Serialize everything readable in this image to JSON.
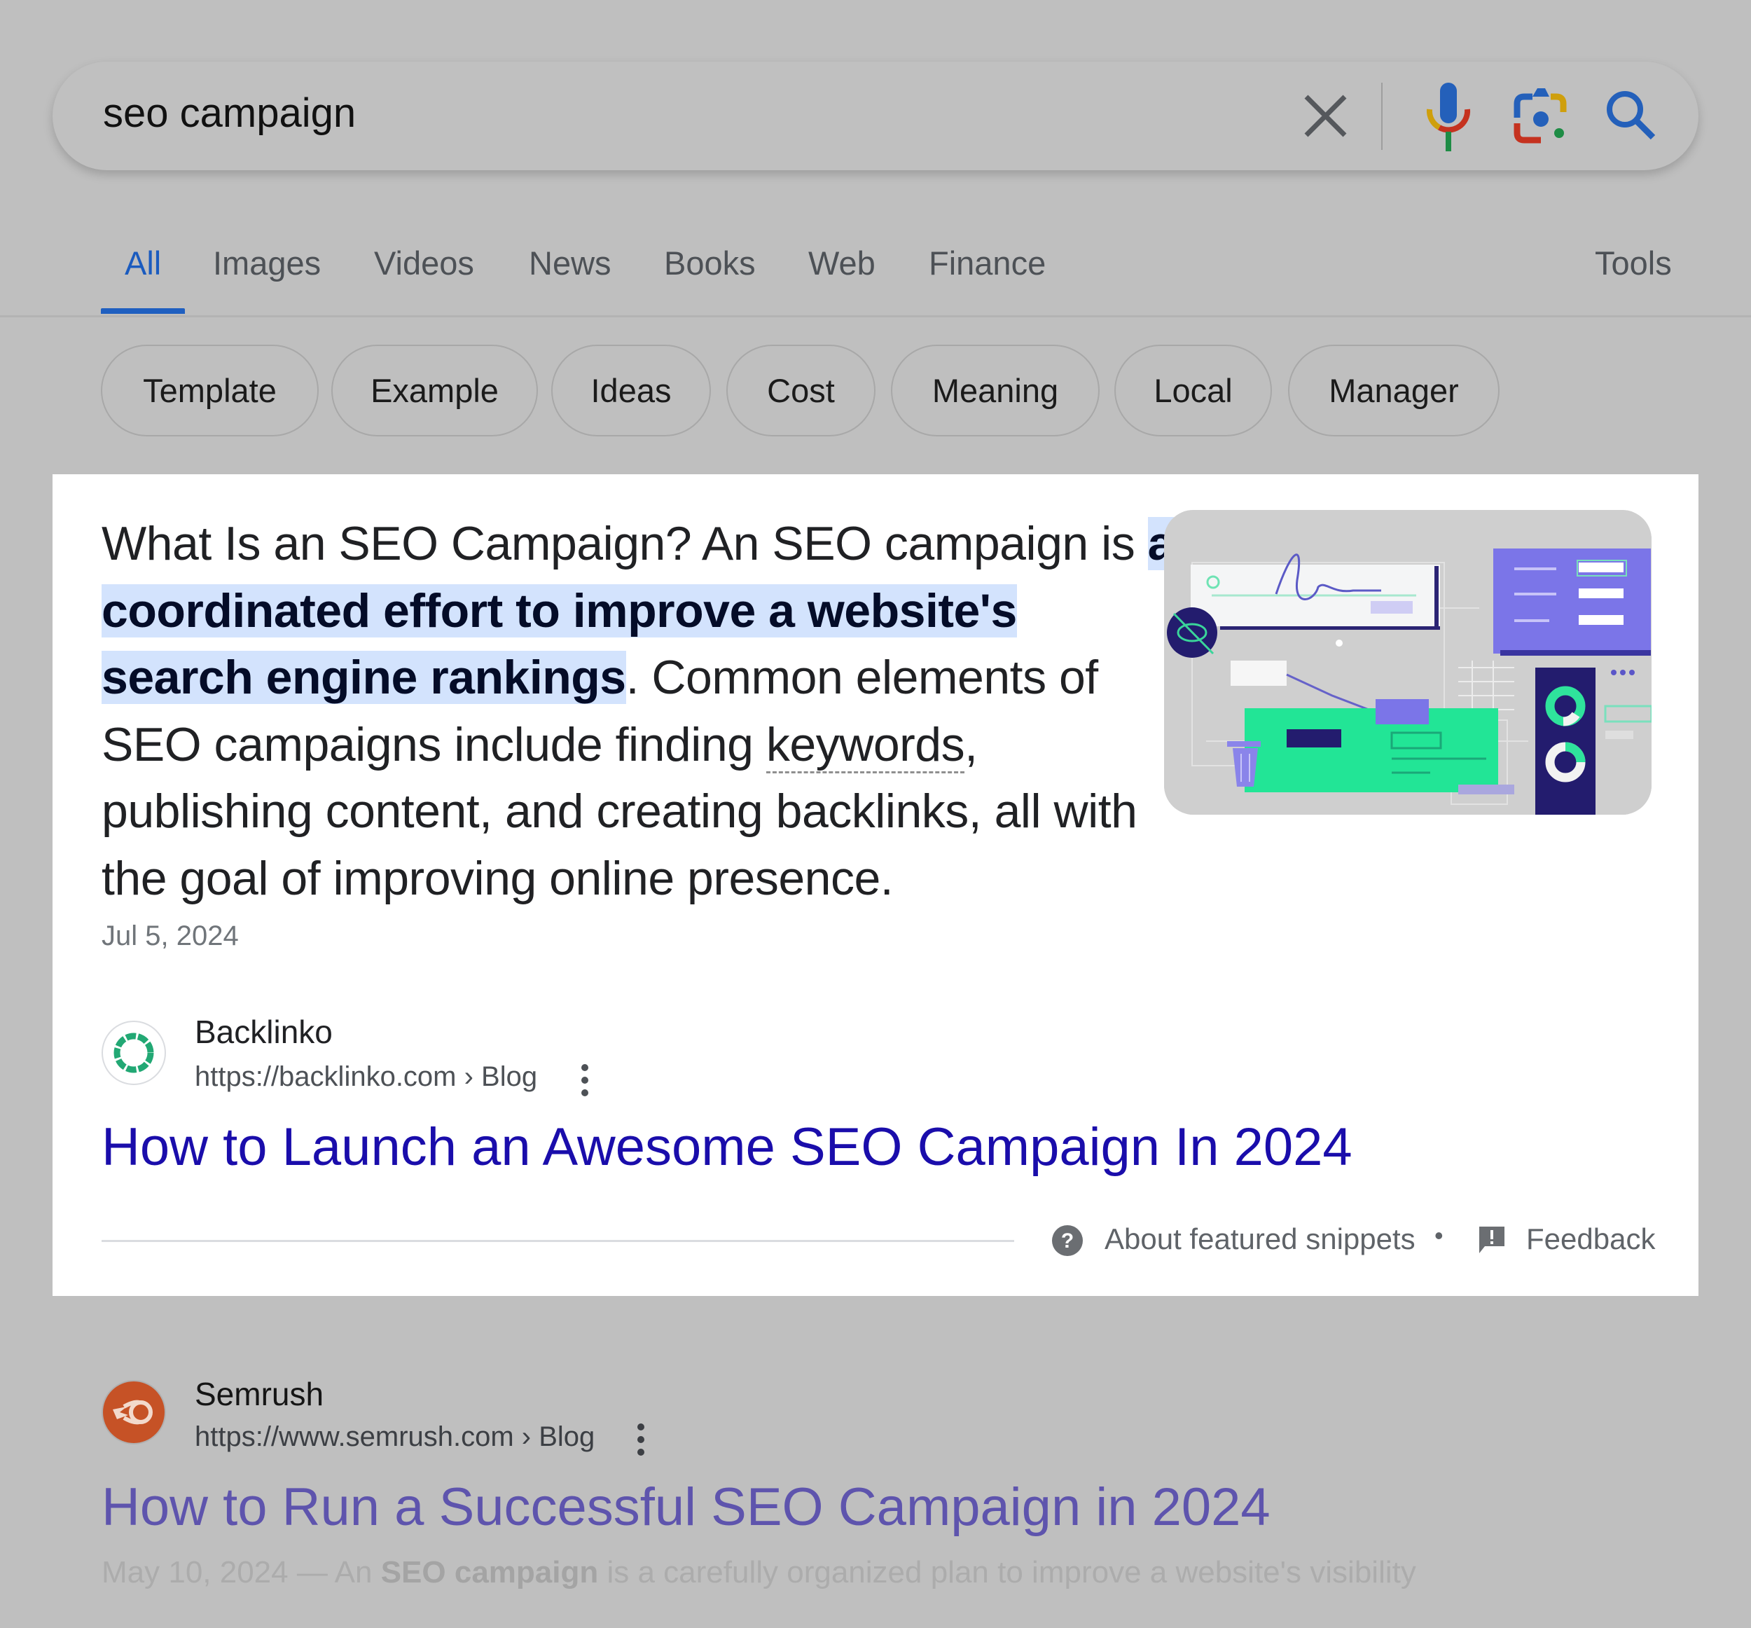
{
  "search": {
    "query": "seo campaign",
    "icons": [
      "close-icon",
      "microphone-icon",
      "google-lens-icon",
      "search-icon"
    ]
  },
  "tabs": [
    {
      "label": "All",
      "active": true
    },
    {
      "label": "Images",
      "active": false
    },
    {
      "label": "Videos",
      "active": false
    },
    {
      "label": "News",
      "active": false
    },
    {
      "label": "Books",
      "active": false
    },
    {
      "label": "Web",
      "active": false
    },
    {
      "label": "Finance",
      "active": false
    }
  ],
  "tools_label": "Tools",
  "chips": [
    "Template",
    "Example",
    "Ideas",
    "Cost",
    "Meaning",
    "Local",
    "Manager"
  ],
  "featured_snippet": {
    "text_before": "What Is an SEO Campaign? An SEO campaign is ",
    "highlight": "a coordinated effort to improve a website's search engine rankings",
    "text_mid": ". Common elements of SEO campaigns include finding ",
    "keyword_link": "keywords",
    "text_after": ", publishing content, and creating backlinks, all with the goal of improving online presence.",
    "date": "Jul 5, 2024",
    "image_alt": "SEO campaign illustration",
    "source": {
      "name": "Backlinko",
      "url": "https://backlinko.com",
      "breadcrumb": "Blog",
      "title": "How to Launch an Awesome SEO Campaign In 2024"
    },
    "footer": {
      "about_label": "About featured snippets",
      "separator": "•",
      "feedback_label": "Feedback"
    }
  },
  "results": [
    {
      "name": "Semrush",
      "url": "https://www.semrush.com",
      "breadcrumb": "Blog",
      "title": "How to Run a Successful SEO Campaign in 2024",
      "snippet_date": "May 10, 2024",
      "snippet_dash": " — An ",
      "snippet_bold": "SEO campaign",
      "snippet_rest": " is a carefully organized plan to improve a website's visibility"
    }
  ],
  "colors": {
    "page_bg": "#bfbfbf",
    "card_bg": "#ffffff",
    "active_tab": "#1a5bbf",
    "highlight_bg": "#d3e3fd",
    "link": "#1a0dab",
    "visited_link": "#5e54ad"
  }
}
